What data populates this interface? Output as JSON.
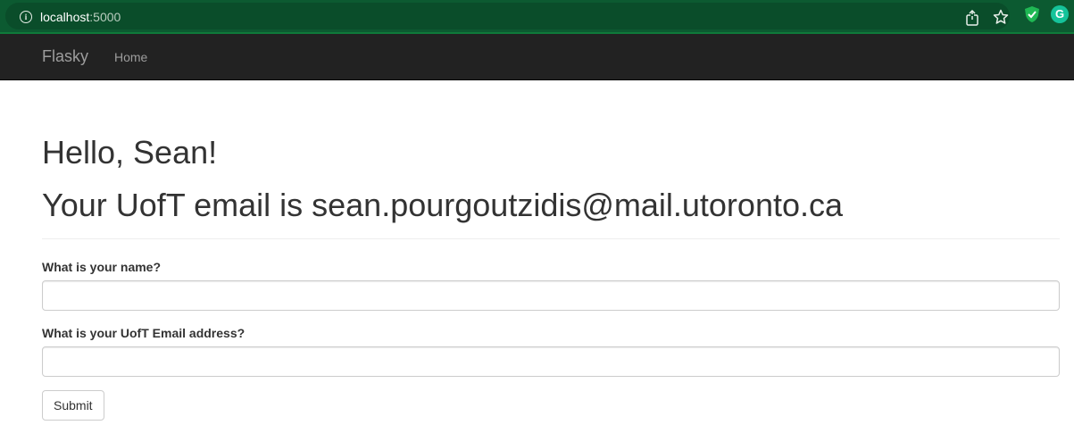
{
  "browser": {
    "url_host": "localhost",
    "url_port": ":5000",
    "icons": [
      "info-icon",
      "share-icon",
      "bookmark-star-icon",
      "shield-extension-icon",
      "grammarly-extension-icon"
    ],
    "extension_g_letter": "G",
    "colors": {
      "bar": "#0c5a31",
      "pill": "#0a4d2a",
      "shield": "#1fb854",
      "grammarly": "#15c39a"
    }
  },
  "navbar": {
    "brand": "Flasky",
    "items": [
      {
        "label": "Home"
      }
    ],
    "colors": {
      "background": "#222222",
      "text": "#9d9d9d"
    }
  },
  "page": {
    "greeting": "Hello, Sean!",
    "email_message": "Your UofT email is sean.pourgoutzidis@mail.utoronto.ca"
  },
  "form": {
    "name_label": "What is your name?",
    "name_value": "",
    "email_label": "What is your UofT Email address?",
    "email_value": "",
    "submit_label": "Submit"
  }
}
